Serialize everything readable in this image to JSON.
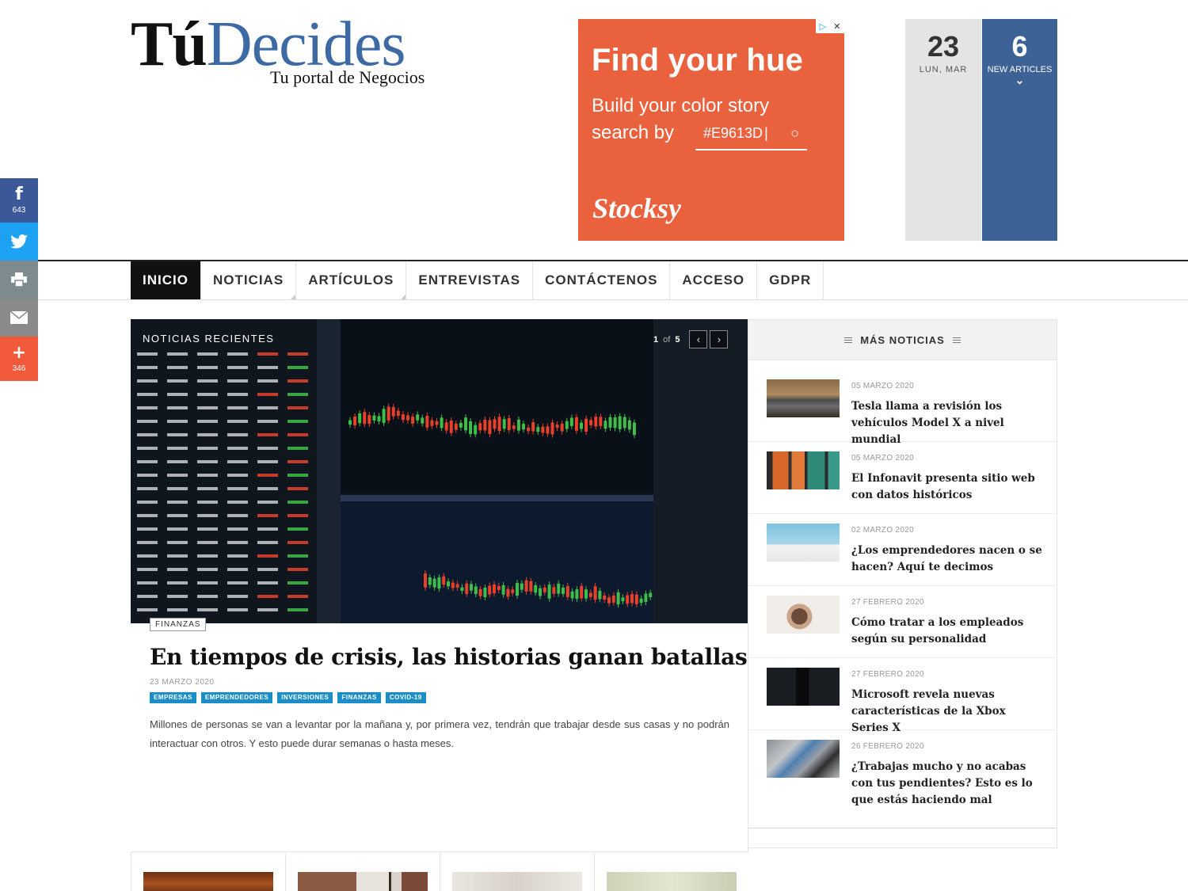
{
  "social": {
    "facebook": {
      "icon": "facebook-icon",
      "glyph": "f",
      "count": "643"
    },
    "twitter": {
      "icon": "twitter-icon"
    },
    "print": {
      "icon": "print-icon"
    },
    "email": {
      "icon": "email-icon"
    },
    "more": {
      "icon": "plus-icon",
      "glyph": "+",
      "count": "346"
    }
  },
  "logo": {
    "part1": "Tú",
    "part2": "Decides",
    "tagline": "Tu portal de Negocios"
  },
  "ad": {
    "headline": "Find your hue",
    "line1": "Build your color story",
    "line2": "search by",
    "hex": "#E9613D",
    "brand": "Stocksy",
    "color": "#e9613d"
  },
  "date_widget": {
    "day": "23",
    "weekday_month": "LUN, MAR"
  },
  "new_articles": {
    "count": "6",
    "label": "NEW ARTICLES"
  },
  "nav": {
    "items": [
      "INICIO",
      "NOTICIAS",
      "ARTÍCULOS",
      "ENTREVISTAS",
      "CONTÁCTENOS",
      "ACCESO",
      "GDPR"
    ]
  },
  "featured": {
    "section_label": "NOTICIAS RECIENTES",
    "pager": {
      "current": "1",
      "of": "of",
      "total": "5"
    },
    "category": "FINANZAS",
    "title": "En tiempos de crisis, las historias ganan batallas",
    "date": "23 MARZO 2020",
    "tags": [
      "EMPRESAS",
      "EMPRENDEDORES",
      "INVERSIONES",
      "FINANZAS",
      "COVID-19"
    ],
    "excerpt": "Millones de personas se van a levantar por la mañana y, por primera vez, tendrán que trabajar desde sus casas y no podrán interactuar con otros. Y esto puede durar semanas o hasta meses."
  },
  "sidebar": {
    "heading": "MÁS NOTICIAS",
    "items": [
      {
        "date": "05 MARZO 2020",
        "title": "Tesla llama a revisión los vehículos Model X a nivel mundial"
      },
      {
        "date": "05 MARZO 2020",
        "title": "El Infonavit presenta sitio web con datos históricos"
      },
      {
        "date": "02 MARZO 2020",
        "title": "¿Los emprendedores nacen o se hacen? Aquí te decimos"
      },
      {
        "date": "27 FEBRERO 2020",
        "title": "Cómo tratar a los empleados según su personalidad"
      },
      {
        "date": "27 FEBRERO 2020",
        "title": "Microsoft revela nuevas características de la Xbox Series X"
      },
      {
        "date": "26 FEBRERO 2020",
        "title": "¿Trabajas mucho y no acabas con tus pendientes? Esto es lo que estás haciendo mal"
      }
    ]
  },
  "colors": {
    "brand_blue": "#3d6aa4",
    "tag_blue": "#1b8ec8",
    "nav_active": "#111111"
  }
}
